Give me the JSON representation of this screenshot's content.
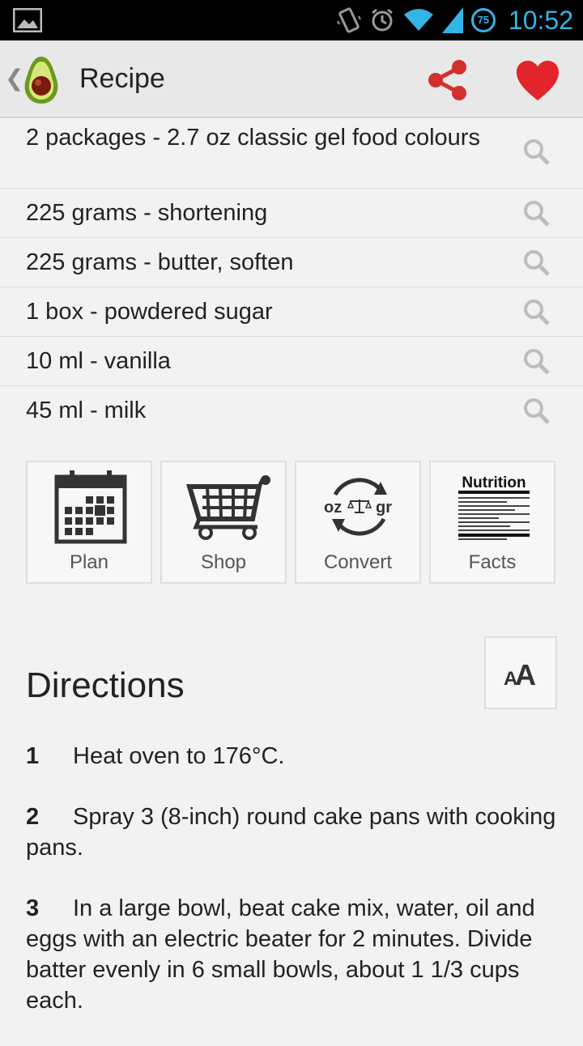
{
  "status_bar": {
    "time": "10:52",
    "battery": "75",
    "icons": [
      "image-notification-icon",
      "vibrate-icon",
      "alarm-icon",
      "wifi-icon",
      "signal-icon",
      "battery-icon"
    ]
  },
  "action_bar": {
    "title": "Recipe",
    "icons": [
      "back-caret-icon",
      "avocado-logo-icon",
      "share-icon",
      "heart-icon"
    ],
    "accent_color": "#d32f2f"
  },
  "ingredients": [
    {
      "text": "2 packages - 2.7 oz classic gel food colours"
    },
    {
      "text": "225 grams - shortening"
    },
    {
      "text": "225 grams - butter, soften"
    },
    {
      "text": "1 box - powdered sugar"
    },
    {
      "text": "10 ml - vanilla"
    },
    {
      "text": "45 ml - milk"
    }
  ],
  "tiles": [
    {
      "label": "Plan",
      "icon": "calendar-icon"
    },
    {
      "label": "Shop",
      "icon": "cart-icon"
    },
    {
      "label": "Convert",
      "icon": "scale-convert-icon",
      "icon_text_left": "oz",
      "icon_text_right": "gr"
    },
    {
      "label": "Facts",
      "icon": "nutrition-label-icon",
      "icon_text": "Nutrition"
    }
  ],
  "directions": {
    "title": "Directions",
    "font_button_icon": "font-size-icon",
    "steps": [
      {
        "num": "1",
        "text": "Heat oven to 176°C."
      },
      {
        "num": "2",
        "text": "Spray 3 (8-inch) round cake pans with cooking pans."
      },
      {
        "num": "3",
        "text": "In a large bowl, beat cake mix, water, oil and eggs with an electric beater for 2 minutes. Divide batter evenly in 6 small bowls, about 1 1/3 cups each."
      }
    ]
  }
}
